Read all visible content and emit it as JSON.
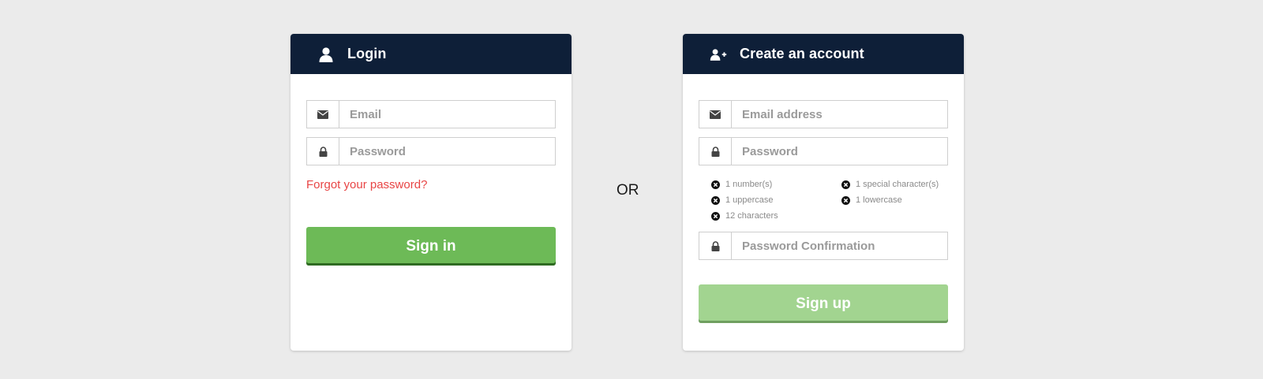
{
  "colors": {
    "background": "#ebebeb",
    "header": "#0e1f38",
    "signin_button": "#6dba57",
    "signup_button_disabled": "#a2d490",
    "link": "#e84545"
  },
  "login": {
    "title": "Login",
    "icon": "user-icon",
    "email_placeholder": "Email",
    "password_placeholder": "Password",
    "forgot_link": "Forgot your password?",
    "signin_label": "Sign in"
  },
  "separator": "OR",
  "signup": {
    "title": "Create an account",
    "icon": "user-plus-icon",
    "email_placeholder": "Email address",
    "password_placeholder": "Password",
    "rules": [
      "1 number(s)",
      "1 special character(s)",
      "1 uppercase",
      "1 lowercase",
      "12 characters"
    ],
    "confirm_placeholder": "Password Confirmation",
    "signup_label": "Sign up"
  }
}
